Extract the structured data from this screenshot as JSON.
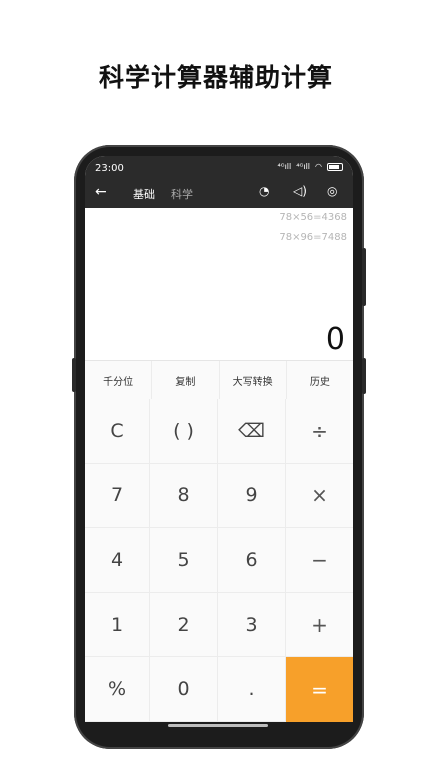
{
  "headline": "科学计算器辅助计算",
  "status": {
    "time": "23:00",
    "sig1": "⁴ᴳıll",
    "sig2": "⁴ᴳıll",
    "wifi": "◠"
  },
  "topbar": {
    "back_icon": "←",
    "tab_basic": "基础",
    "tab_science": "科学",
    "history_icon": "◔",
    "sound_icon": "◁)",
    "theme_icon": "◎"
  },
  "display": {
    "history": [
      "78×56=4368",
      "78×96=7488"
    ],
    "result": "0"
  },
  "functions": [
    "千分位",
    "复制",
    "大写转换",
    "历史"
  ],
  "keys": [
    [
      "C",
      "( )",
      "⌫",
      "÷"
    ],
    [
      "7",
      "8",
      "9",
      "×"
    ],
    [
      "4",
      "5",
      "6",
      "−"
    ],
    [
      "1",
      "2",
      "3",
      "+"
    ],
    [
      "%",
      "0",
      ".",
      "="
    ]
  ],
  "colors": {
    "accent": "#f7a02a",
    "bar": "#2b2b2b"
  }
}
